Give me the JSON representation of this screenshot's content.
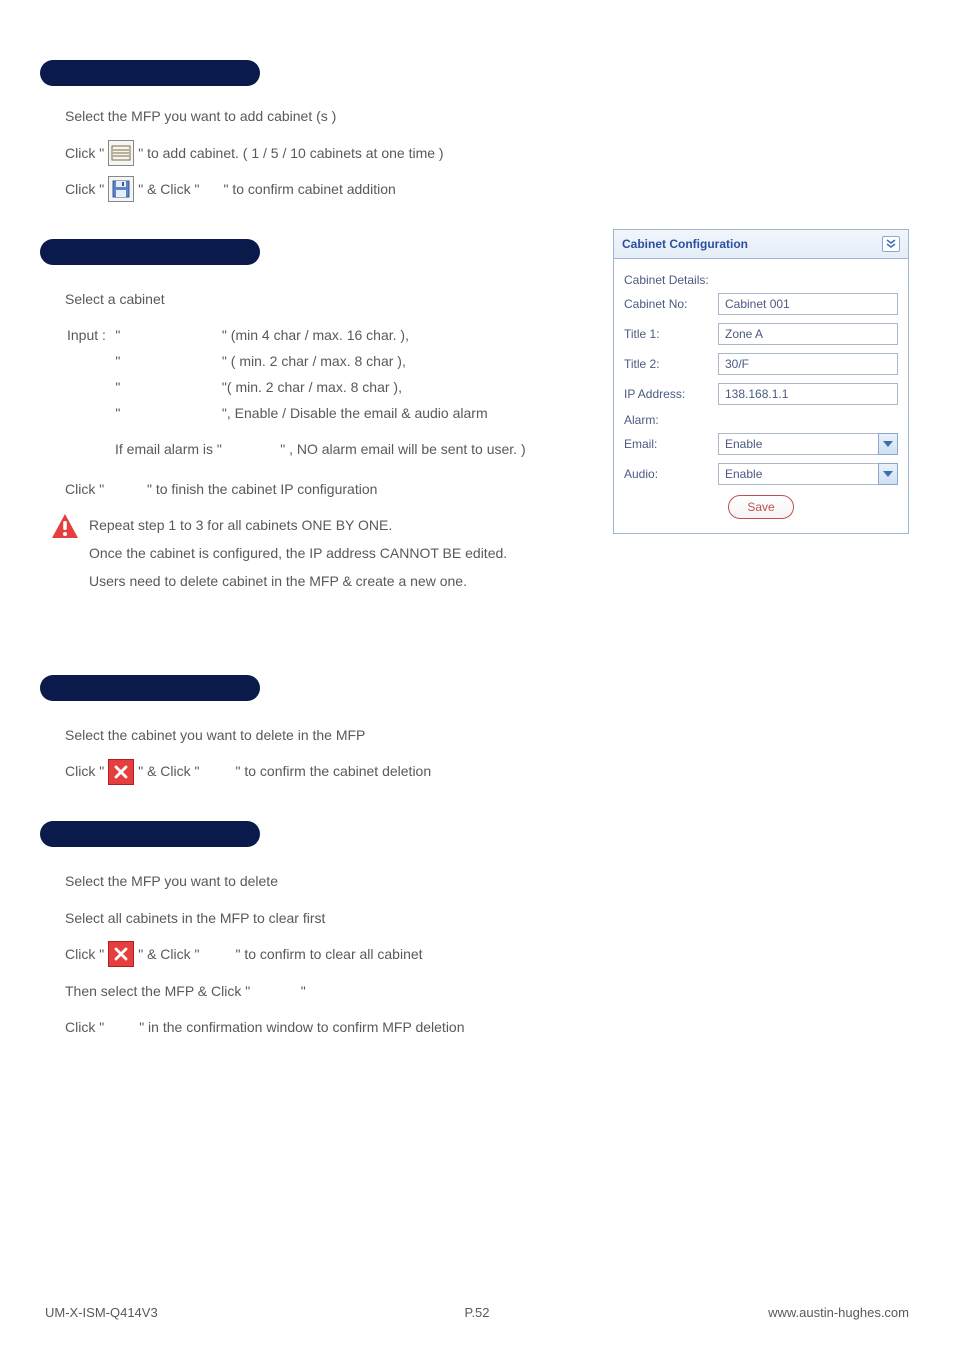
{
  "sections": {
    "add_cabinet": {
      "line1": "Select the MFP you want to add cabinet (s )",
      "line2_a": "Click \" ",
      "line2_b": " \" to add cabinet. ( 1 / 5 / 10 cabinets at one time )",
      "line3_a": "Click \" ",
      "line3_b": " \" & Click \" ",
      "line3_c": " \" to confirm cabinet addition"
    },
    "config": {
      "select": "Select a cabinet",
      "input_prefix": "Input :",
      "rows": [
        {
          "q1": "\"",
          "field": "",
          "q2": "\"",
          "rest": " (min 4 char / max. 16 char. ),"
        },
        {
          "q1": "\"",
          "field": "",
          "q2": "\"",
          "rest": " ( min. 2 char / max. 8 char ),"
        },
        {
          "q1": "\"",
          "field": "",
          "q2": "\"",
          "rest": "( min. 2 char / max. 8 char ),"
        },
        {
          "q1": "\"",
          "field": "",
          "q2": "\"",
          "rest": ", Enable / Disable the email & audio alarm"
        }
      ],
      "note": "If email alarm is \"               \" , NO alarm email will be sent to user. )",
      "finish": "Click \"           \" to finish the cabinet IP configuration",
      "warn1": "Repeat step 1 to 3 for all cabinets ONE BY ONE.",
      "warn2": "Once the cabinet is configured, the IP address CANNOT BE edited.",
      "warn3": "Users need to delete cabinet in the MFP & create a new one."
    },
    "delete_cabinet": {
      "line1": "Select the cabinet you want to delete in the MFP",
      "line2_a": "Click \" ",
      "line2_b": " \" & Click \" ",
      "line2_c": " \" to confirm the cabinet deletion"
    },
    "delete_mfp": {
      "line1": "Select the MFP you want to delete",
      "line2": "Select all cabinets in the MFP to clear first",
      "line3_a": "Click \" ",
      "line3_b": " \" & Click \" ",
      "line3_c": " \" to confirm to clear all cabinet",
      "line4": "Then select the MFP & Click \"             \"",
      "line5": "Click \"         \" in the confirmation window to confirm MFP deletion"
    }
  },
  "panel": {
    "title": "Cabinet Configuration",
    "details": "Cabinet Details:",
    "labels": {
      "no": "Cabinet No:",
      "t1": "Title 1:",
      "t2": "Title 2:",
      "ip": "IP Address:",
      "alarm": "Alarm:",
      "email": "Email:",
      "audio": "Audio:"
    },
    "values": {
      "no": "Cabinet 001",
      "t1": "Zone A",
      "t2": "30/F",
      "ip": "138.168.1.1",
      "email": "Enable",
      "audio": "Enable"
    },
    "save": "Save"
  },
  "footer": {
    "left": "UM-X-ISM-Q414V3",
    "center": "P.52",
    "right": "www.austin-hughes.com"
  }
}
